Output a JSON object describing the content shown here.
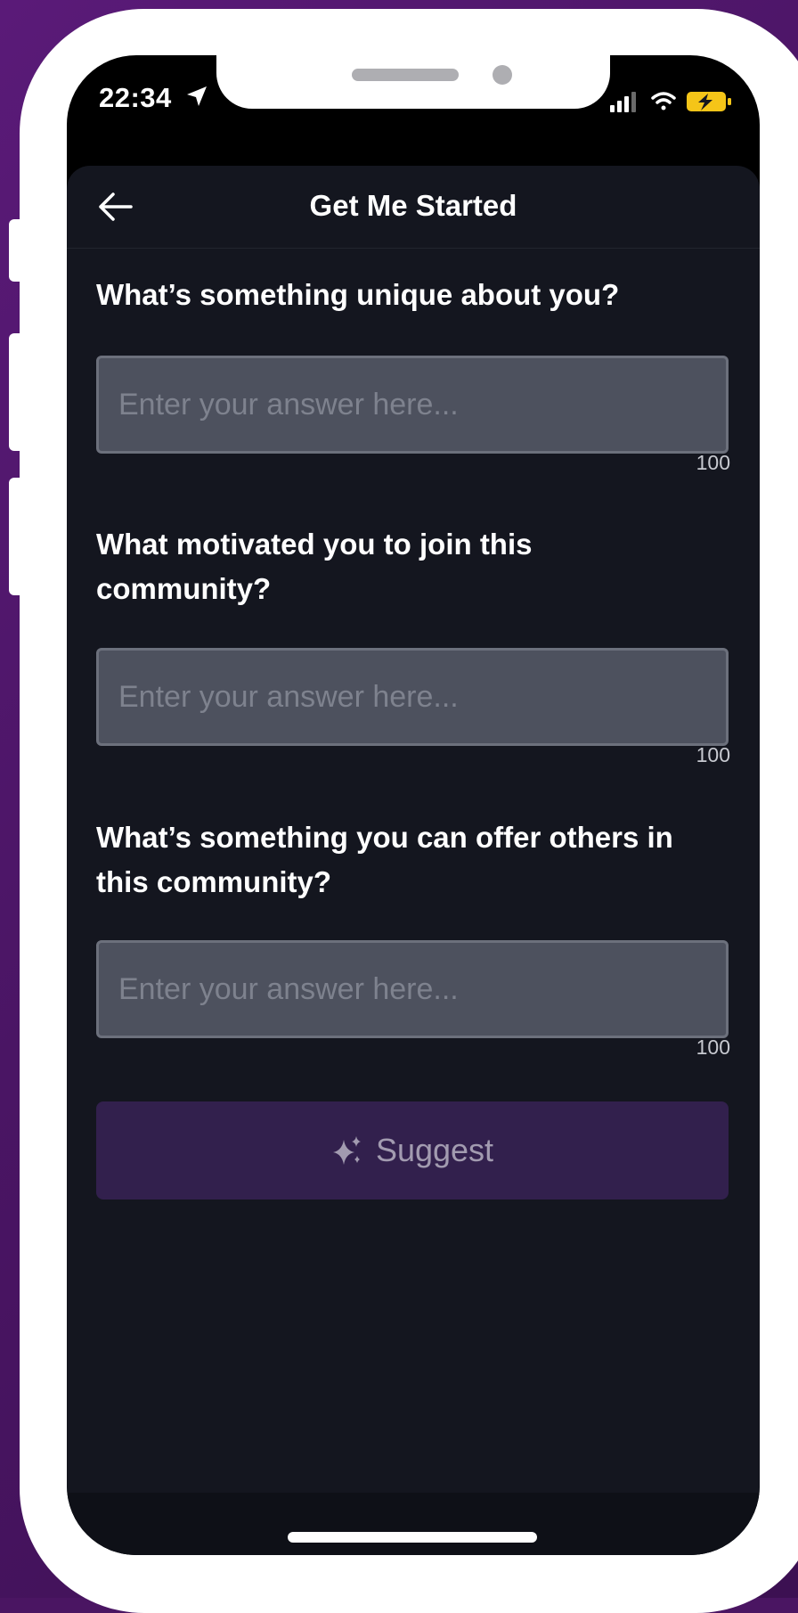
{
  "status_bar": {
    "time": "22:34",
    "icons": [
      "location-arrow-icon",
      "cellular-signal-icon",
      "wifi-icon",
      "battery-charging-icon"
    ]
  },
  "nav": {
    "title": "Get Me Started",
    "back_icon": "back-arrow-icon"
  },
  "questions": [
    {
      "label": "What’s something unique about you?",
      "placeholder": "Enter your answer here...",
      "value": "",
      "counter": "100"
    },
    {
      "label": "What motivated you to join this community?",
      "placeholder": "Enter your answer here...",
      "value": "",
      "counter": "100"
    },
    {
      "label": "What’s something you can offer others in this community?",
      "placeholder": "Enter your answer here...",
      "value": "",
      "counter": "100"
    }
  ],
  "suggest_button": {
    "label": "Suggest",
    "icon": "sparkles-icon"
  },
  "colors": {
    "background": "#4a1562",
    "sheet": "#14161f",
    "input_fill": "#4d515e",
    "suggest_fill": "#32204d",
    "battery": "#f5c518"
  }
}
